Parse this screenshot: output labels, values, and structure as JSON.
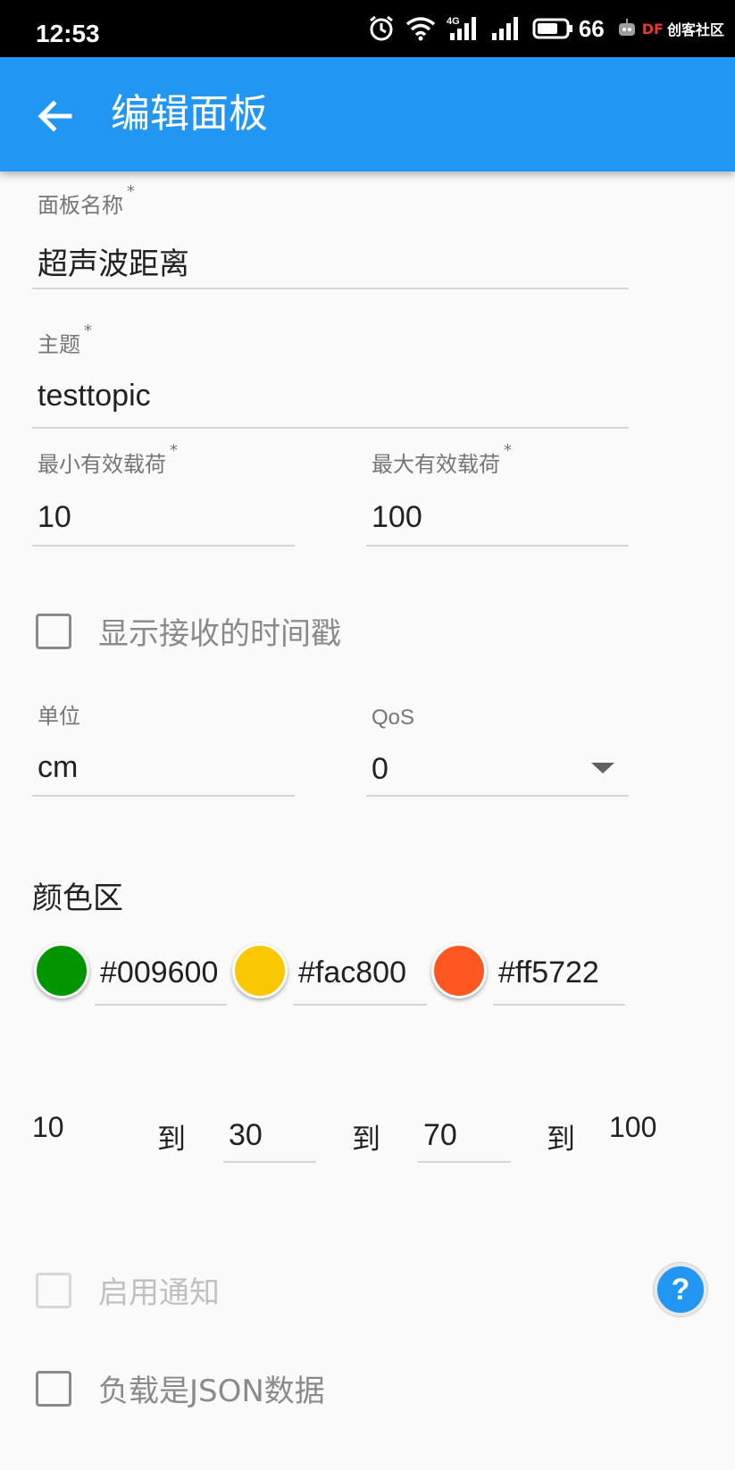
{
  "status_bar": {
    "time": "12:53",
    "battery": "66",
    "network": "4G",
    "watermark_brand": "DF",
    "watermark_text": "创客社区"
  },
  "app_bar": {
    "title": "编辑面板",
    "back_icon": "arrow-back-icon"
  },
  "form": {
    "panel_name": {
      "label": "面板名称",
      "required_mark": "*",
      "value": "超声波距离"
    },
    "topic": {
      "label": "主题",
      "required_mark": "*",
      "value": "testtopic"
    },
    "min_payload": {
      "label": "最小有效载荷",
      "required_mark": "*",
      "value": "10"
    },
    "max_payload": {
      "label": "最大有效载荷",
      "required_mark": "*",
      "value": "100"
    },
    "show_timestamp": {
      "label": "显示接收的时间戳",
      "checked": false
    },
    "unit": {
      "label": "单位",
      "value": "cm"
    },
    "qos": {
      "label": "QoS",
      "value": "0"
    }
  },
  "color_zone": {
    "title": "颜色区",
    "colors": [
      {
        "hex": "#009600",
        "display": "#009600"
      },
      {
        "hex": "#fac800",
        "display": "#fac800"
      },
      {
        "hex": "#ff5722",
        "display": "#ff5722"
      }
    ],
    "range": {
      "start": "10",
      "to_label": "到",
      "mid1": "30",
      "mid2": "70",
      "end": "100"
    }
  },
  "options": {
    "enable_notification": {
      "label": "启用通知",
      "checked": false,
      "disabled": true
    },
    "help_symbol": "?",
    "json_payload": {
      "label": "负载是JSON数据",
      "checked": false
    }
  },
  "colors": {
    "accent": "#2196f3",
    "status_bar": "#000000",
    "background": "#fafafa"
  }
}
